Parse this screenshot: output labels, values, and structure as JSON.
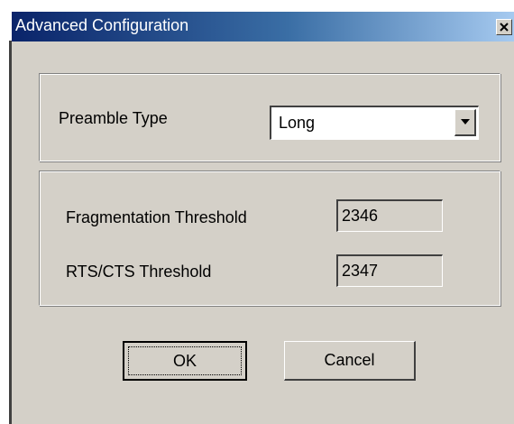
{
  "window": {
    "title": "Advanced Configuration"
  },
  "preamble": {
    "label": "Preamble Type",
    "selected": "Long"
  },
  "thresholds": {
    "fragmentation_label": "Fragmentation Threshold",
    "fragmentation_value": "2346",
    "rts_cts_label": "RTS/CTS Threshold",
    "rts_cts_value": "2347"
  },
  "buttons": {
    "ok_label": "OK",
    "cancel_label": "Cancel"
  },
  "icons": {
    "close": "close-icon",
    "dropdown": "chevron-down-icon"
  }
}
